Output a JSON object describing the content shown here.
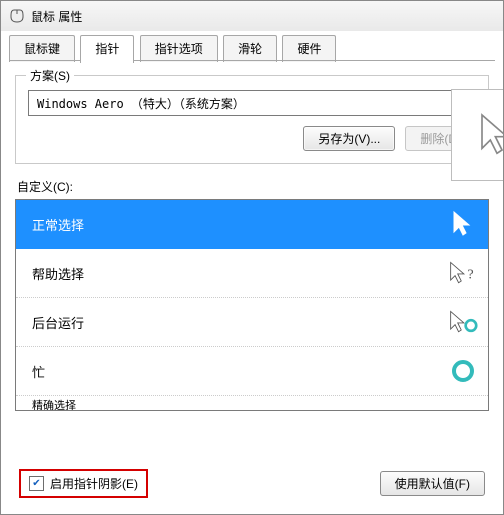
{
  "window": {
    "title": "鼠标 属性"
  },
  "tabs": [
    {
      "label": "鼠标键"
    },
    {
      "label": "指针"
    },
    {
      "label": "指针选项"
    },
    {
      "label": "滑轮"
    },
    {
      "label": "硬件"
    }
  ],
  "active_tab": 1,
  "scheme": {
    "legend": "方案(S)",
    "selected": "Windows Aero （特大）（系统方案）",
    "save_as": "另存为(V)...",
    "delete": "删除(D)"
  },
  "customize_label": "自定义(C):",
  "cursors": [
    {
      "label": "正常选择",
      "icon": "arrow"
    },
    {
      "label": "帮助选择",
      "icon": "arrow-help"
    },
    {
      "label": "后台运行",
      "icon": "arrow-busy"
    },
    {
      "label": "忙",
      "icon": "busy"
    },
    {
      "label": "精确选择",
      "icon": "cross"
    }
  ],
  "selected_cursor": 0,
  "shadow": {
    "checked": true,
    "label": "启用指针阴影(E)"
  },
  "use_default": "使用默认值(F)"
}
